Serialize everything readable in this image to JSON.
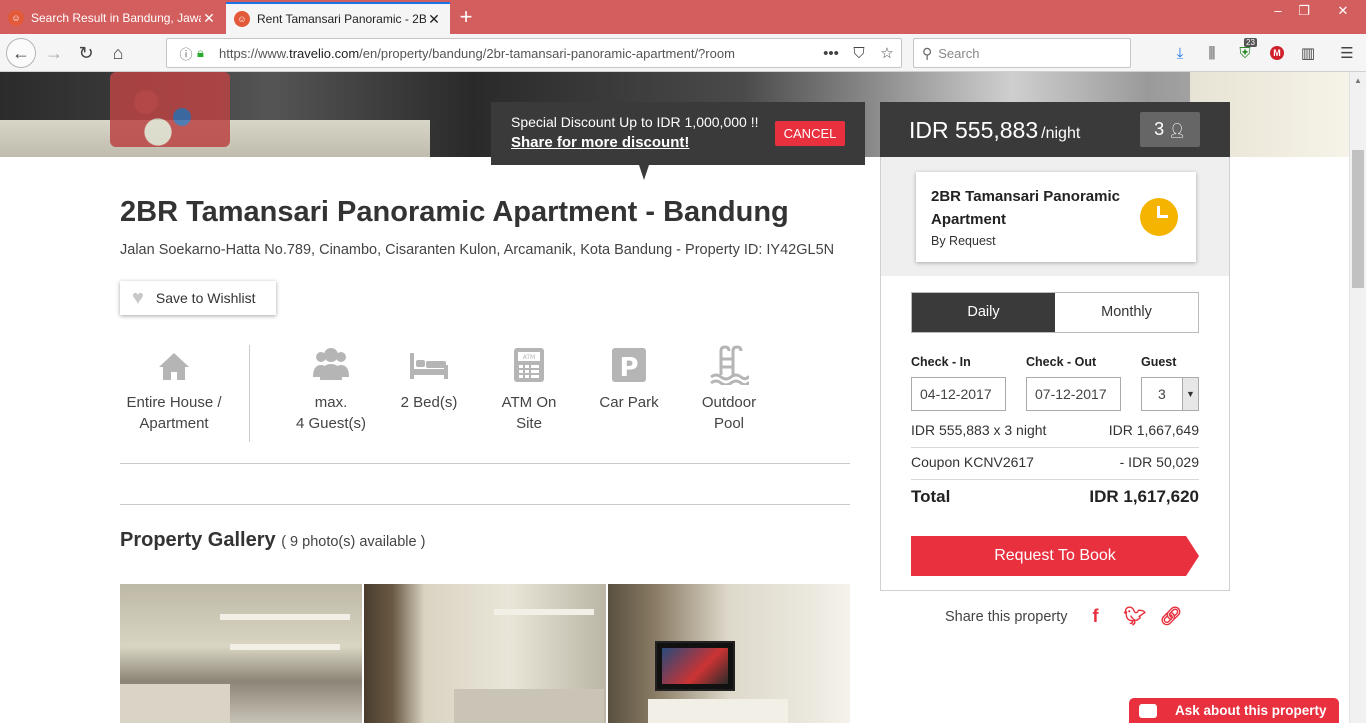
{
  "browser": {
    "tabs": [
      {
        "title": "Search Result in Bandung, Jawa",
        "active": false
      },
      {
        "title": "Rent Tamansari Panoramic - 2B",
        "active": true
      }
    ],
    "url_prefix": "https://www.",
    "url_domain": "travelio.com",
    "url_path": "/en/property/bandung/2br-tamansari-panoramic-apartment/?room",
    "search_placeholder": "Search",
    "badge_count": "23"
  },
  "promo": {
    "text": "Special Discount Up to IDR 1,000,000 !!",
    "link": "Share for more discount!",
    "cancel_label": "CANCEL"
  },
  "property": {
    "title": "2BR Tamansari Panoramic Apartment - Bandung",
    "address": "Jalan Soekarno-Hatta No.789, Cinambo, Cisaranten Kulon, Arcamanik, Kota Bandung - Property ID: IY42GL5N",
    "wishlist_label": "Save to Wishlist",
    "amenities": [
      {
        "icon": "house-icon",
        "line1": "Entire House /",
        "line2": "Apartment"
      },
      {
        "icon": "guests-icon",
        "line1": "max.",
        "line2": "4 Guest(s)"
      },
      {
        "icon": "bed-icon",
        "line1": "2 Bed(s)",
        "line2": ""
      },
      {
        "icon": "atm-icon",
        "line1": "ATM On",
        "line2": "Site"
      },
      {
        "icon": "parking-icon",
        "line1": "Car Park",
        "line2": ""
      },
      {
        "icon": "pool-icon",
        "line1": "Outdoor",
        "line2": "Pool"
      }
    ]
  },
  "gallery": {
    "title": "Property Gallery",
    "count_text": "( 9 photo(s) available )"
  },
  "booking": {
    "price": "IDR 555,883",
    "per_night": "/night",
    "guests": "3",
    "card_name": "2BR Tamansari Panoramic Apartment",
    "card_sub": "By Request",
    "tabs": [
      "Daily",
      "Monthly"
    ],
    "active_tab": "Daily",
    "checkin_label": "Check - In",
    "checkout_label": "Check - Out",
    "guest_label": "Guest",
    "checkin_value": "04-12-2017",
    "checkout_value": "07-12-2017",
    "guest_value": "3",
    "lines": [
      {
        "label": "IDR 555,883 x 3 night",
        "value": "IDR 1,667,649"
      },
      {
        "label": "Coupon KCNV2617",
        "value": "- IDR 50,029"
      }
    ],
    "total_label": "Total",
    "total_value": "IDR 1,617,620",
    "book_label": "Request To Book"
  },
  "share": {
    "label": "Share this property"
  },
  "chat": {
    "label": "Ask about this property"
  },
  "colors": {
    "accent": "#e8303e",
    "dark": "#3a3a3a",
    "tabbar": "#d35e5e",
    "clock": "#f5b400"
  }
}
